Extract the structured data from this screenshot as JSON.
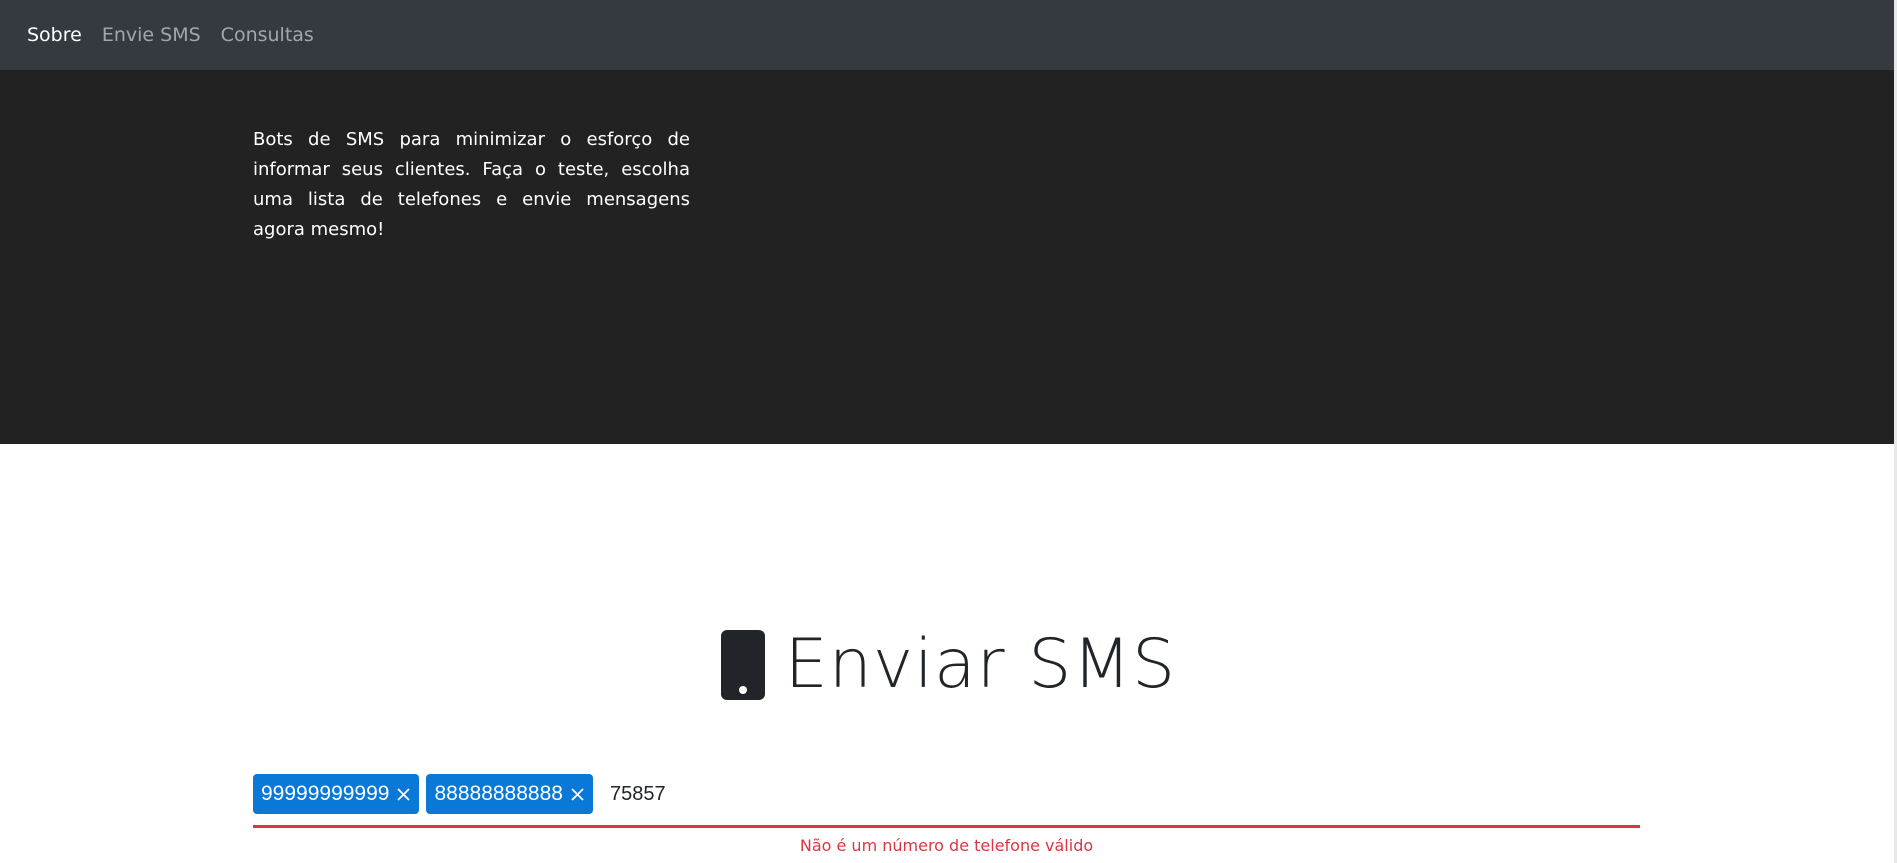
{
  "nav": {
    "items": [
      {
        "label": "Sobre",
        "active": true
      },
      {
        "label": "Envie SMS",
        "active": false
      },
      {
        "label": "Consultas",
        "active": false
      }
    ]
  },
  "hero": {
    "text": "Bots de SMS para minimizar o esforço de informar seus clientes. Faça o teste, escolha uma lista de telefones e envie mensagens agora mesmo!"
  },
  "form": {
    "icon": "phone-icon",
    "title": "Enviar SMS",
    "tags": [
      "99999999999",
      "88888888888"
    ],
    "input_value": "75857",
    "error": "Não é um número de telefone válido"
  },
  "colors": {
    "navbar": "#343a40",
    "hero": "#222222",
    "tag": "#0a78d7",
    "error": "#dc3545"
  }
}
